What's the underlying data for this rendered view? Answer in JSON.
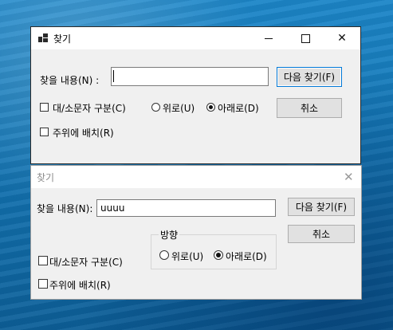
{
  "window1": {
    "title": "찾기",
    "find_label": "찾을 내용(N) :",
    "find_value": "",
    "find_next_label": "다음 찾기(F)",
    "cancel_label": "취소",
    "match_case_label": "대/소문자 구분(C)",
    "match_case_checked": false,
    "up_label": "위로(U)",
    "down_label": "아래로(D)",
    "direction_selected": "down",
    "wrap_label": "주위에 배치(R)",
    "wrap_checked": false
  },
  "window2": {
    "title": "찾기",
    "find_label": "찾을 내용(N):",
    "find_value": "uuuu",
    "find_next_label": "다음 찾기(F)",
    "cancel_label": "취소",
    "direction_group_label": "방향",
    "up_label": "위로(U)",
    "down_label": "아래로(D)",
    "direction_selected": "down",
    "match_case_label": "대/소문자 구분(C)",
    "match_case_checked": false,
    "wrap_label": "주위에 배치(R)",
    "wrap_checked": false
  },
  "icons": {
    "app": "find-app-icon",
    "minimize": "minimize-icon",
    "maximize": "maximize-icon",
    "close": "close-icon"
  },
  "colors": {
    "focus_border": "#0078d7",
    "dialog_bg": "#f0f0f0",
    "inactive_title": "#8a8a8a"
  }
}
